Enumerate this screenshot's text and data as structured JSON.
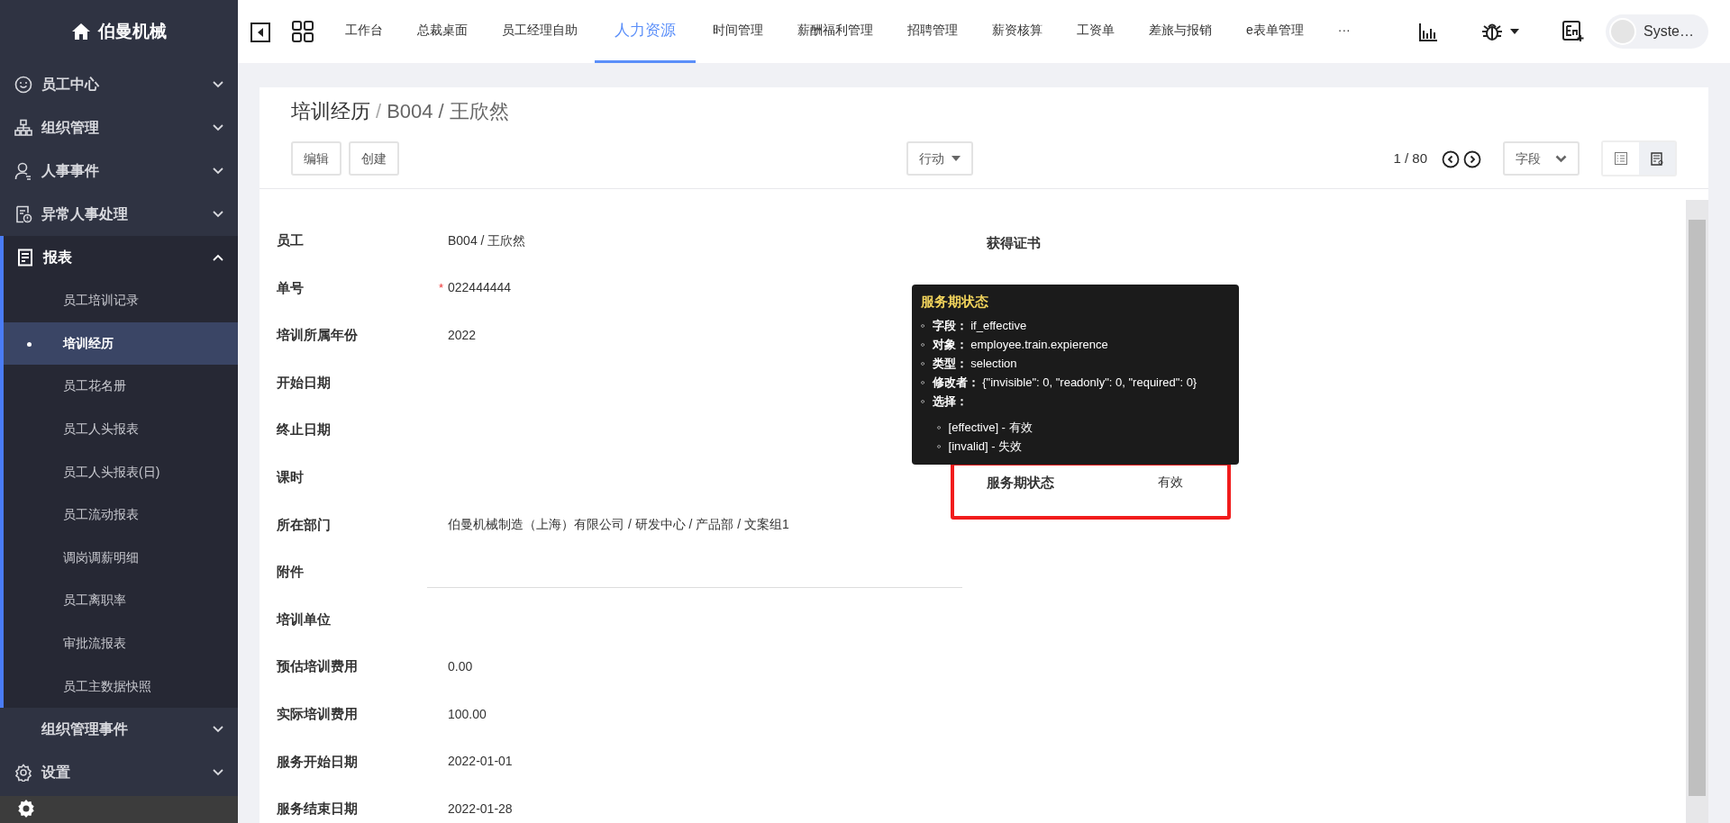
{
  "sidebar": {
    "brand": "伯曼机械",
    "items": [
      {
        "label": "员工中心",
        "expanded": false
      },
      {
        "label": "组织管理",
        "expanded": false
      },
      {
        "label": "人事事件",
        "expanded": false
      },
      {
        "label": "异常人事处理",
        "expanded": false
      },
      {
        "label": "报表",
        "expanded": true,
        "children": [
          {
            "label": "员工培训记录",
            "selected": false
          },
          {
            "label": "培训经历",
            "selected": true
          },
          {
            "label": "员工花名册",
            "selected": false
          },
          {
            "label": "员工人头报表",
            "selected": false
          },
          {
            "label": "员工人头报表(日)",
            "selected": false
          },
          {
            "label": "员工流动报表",
            "selected": false
          },
          {
            "label": "调岗调薪明细",
            "selected": false
          },
          {
            "label": "员工离职率",
            "selected": false
          },
          {
            "label": "审批流报表",
            "selected": false
          },
          {
            "label": "员工主数据快照",
            "selected": false
          }
        ]
      },
      {
        "label": "组织管理事件",
        "expanded": false
      },
      {
        "label": "设置",
        "expanded": false
      }
    ]
  },
  "topbar": {
    "tabs": [
      {
        "label": "工作台",
        "selected": false
      },
      {
        "label": "总裁桌面",
        "selected": false
      },
      {
        "label": "员工经理自助",
        "selected": false
      },
      {
        "label": "人力资源",
        "selected": true
      },
      {
        "label": "时间管理",
        "selected": false
      },
      {
        "label": "薪酬福利管理",
        "selected": false
      },
      {
        "label": "招聘管理",
        "selected": false
      },
      {
        "label": "薪资核算",
        "selected": false
      },
      {
        "label": "工资单",
        "selected": false
      },
      {
        "label": "差旅与报销",
        "selected": false
      },
      {
        "label": "e表单管理",
        "selected": false
      },
      {
        "label": "···",
        "selected": false
      }
    ],
    "user": "Syste…"
  },
  "breadcrumb": [
    "培训经历",
    "B004 / 王欣然"
  ],
  "breadcrumb_separator": "/",
  "required_mark": "*",
  "buttons": [
    "编辑",
    "创建"
  ],
  "action_menu": "行动",
  "pager": "1 / 80",
  "fields_menu": "字段",
  "views": [
    {
      "kind": "list",
      "selected": false
    },
    {
      "kind": "form",
      "selected": true
    }
  ],
  "form": {
    "left": [
      {
        "label": "员工",
        "value": "B004 / 王欣然",
        "required": false
      },
      {
        "label": "单号",
        "value": "022444444",
        "required": true
      },
      {
        "label": "培训所属年份",
        "value": "2022",
        "required": false
      },
      {
        "label": "开始日期",
        "required": false
      },
      {
        "label": "终止日期",
        "required": false
      },
      {
        "label": "课时",
        "required": false
      },
      {
        "label": "所在部门",
        "value": "伯曼机械制造（上海）有限公司 / 研发中心 / 产品部 / 文案组1",
        "required": false
      },
      {
        "label": "附件",
        "kind": "upload",
        "required": false
      },
      {
        "label": "培训单位",
        "required": false
      },
      {
        "label": "预估培训费用",
        "value": "0.00",
        "required": false
      },
      {
        "label": "实际培训费用",
        "value": "100.00",
        "required": false
      },
      {
        "label": "服务开始日期",
        "value": "2022-01-01",
        "required": false
      },
      {
        "label": "服务结束日期",
        "value": "2022-01-28",
        "required": false
      }
    ],
    "right": [
      {
        "label": "获得证书",
        "highlighted": false
      },
      {
        "label": "服务期状态",
        "value": "有效",
        "highlighted": true
      }
    ]
  },
  "tooltip": {
    "title": "服务期状态",
    "bullet": "◦",
    "entries": [
      "**字段：** if_effective",
      "**对象：** employee.train.expierence",
      "**类型：** selection",
      "**修改者：** {\"invisible\": 0, \"readonly\": 0, \"required\": 0}",
      "**选择：**"
    ],
    "options": [
      "[effective] - 有效",
      "[invalid] - 失效"
    ]
  }
}
